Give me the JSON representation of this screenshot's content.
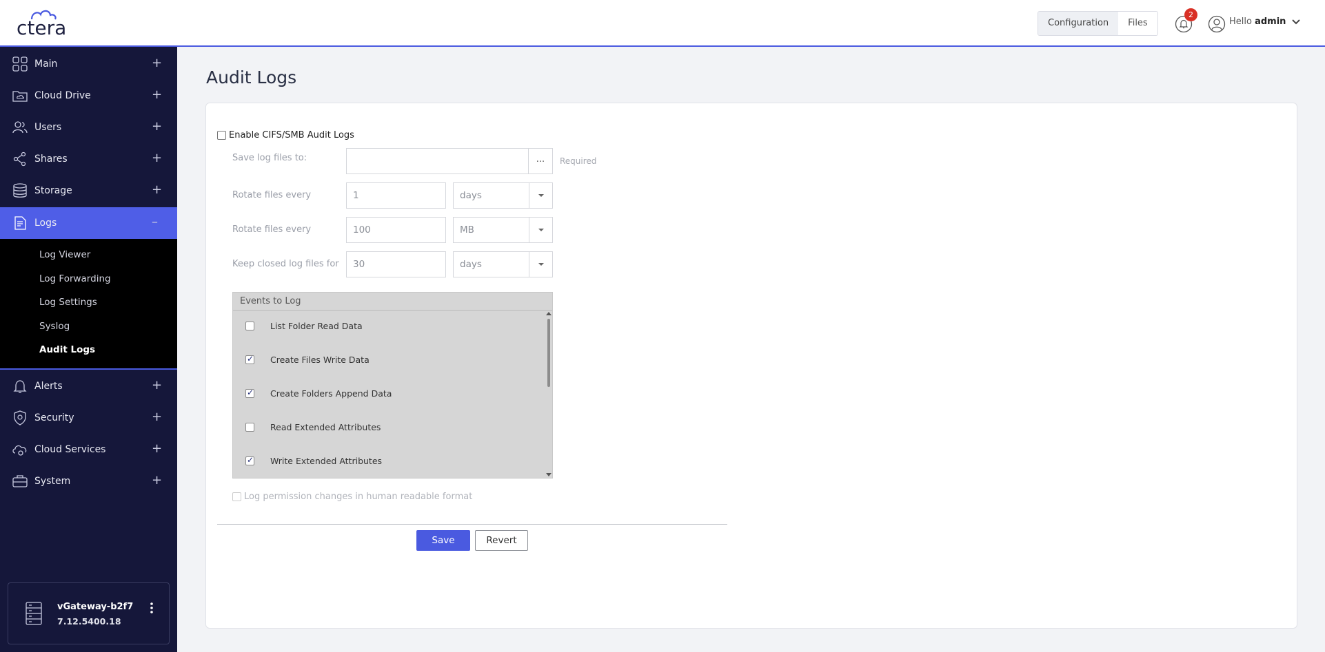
{
  "header": {
    "logo": "ctera",
    "modes": [
      "Configuration",
      "Files"
    ],
    "active_mode": "Configuration",
    "notification_count": "2",
    "greeting": "Hello",
    "username": "admin"
  },
  "sidebar": {
    "items": [
      {
        "label": "Main",
        "icon": "grid-icon"
      },
      {
        "label": "Cloud Drive",
        "icon": "cloud-folder-icon"
      },
      {
        "label": "Users",
        "icon": "users-icon"
      },
      {
        "label": "Shares",
        "icon": "share-icon"
      },
      {
        "label": "Storage",
        "icon": "storage-icon"
      },
      {
        "label": "Logs",
        "icon": "logs-icon"
      },
      {
        "label": "Alerts",
        "icon": "bell-icon"
      },
      {
        "label": "Security",
        "icon": "shield-icon"
      },
      {
        "label": "Cloud Services",
        "icon": "cloud-gear-icon"
      },
      {
        "label": "System",
        "icon": "briefcase-icon"
      }
    ],
    "logs_submenu": [
      "Log Viewer",
      "Log Forwarding",
      "Log Settings",
      "Syslog",
      "Audit Logs"
    ],
    "active_subitem": "Audit Logs",
    "device": {
      "name": "vGateway-b2f7",
      "version": "7.12.5400.18"
    }
  },
  "page": {
    "title": "Audit Logs",
    "enable_label": "Enable CIFS/SMB Audit Logs",
    "save_log_label": "Save log files to:",
    "save_log_value": "",
    "browse_label": "...",
    "required_label": "Required",
    "rotate_time_label": "Rotate files every",
    "rotate_time_value": "1",
    "rotate_time_unit": "days",
    "rotate_size_label": "Rotate files every",
    "rotate_size_value": "100",
    "rotate_size_unit": "MB",
    "keep_label": "Keep closed log files for",
    "keep_value": "30",
    "keep_unit": "days",
    "events_header": "Events to Log",
    "events": [
      {
        "label": "List Folder Read Data",
        "checked": false
      },
      {
        "label": "Create Files Write Data",
        "checked": true
      },
      {
        "label": "Create Folders Append Data",
        "checked": true
      },
      {
        "label": "Read Extended Attributes",
        "checked": false
      },
      {
        "label": "Write Extended Attributes",
        "checked": true
      }
    ],
    "perm_label": "Log permission changes in human readable format",
    "save_button": "Save",
    "revert_button": "Revert"
  },
  "colors": {
    "accent": "#4f5ee7",
    "sidebar": "#15173a",
    "badge": "#d93025"
  }
}
